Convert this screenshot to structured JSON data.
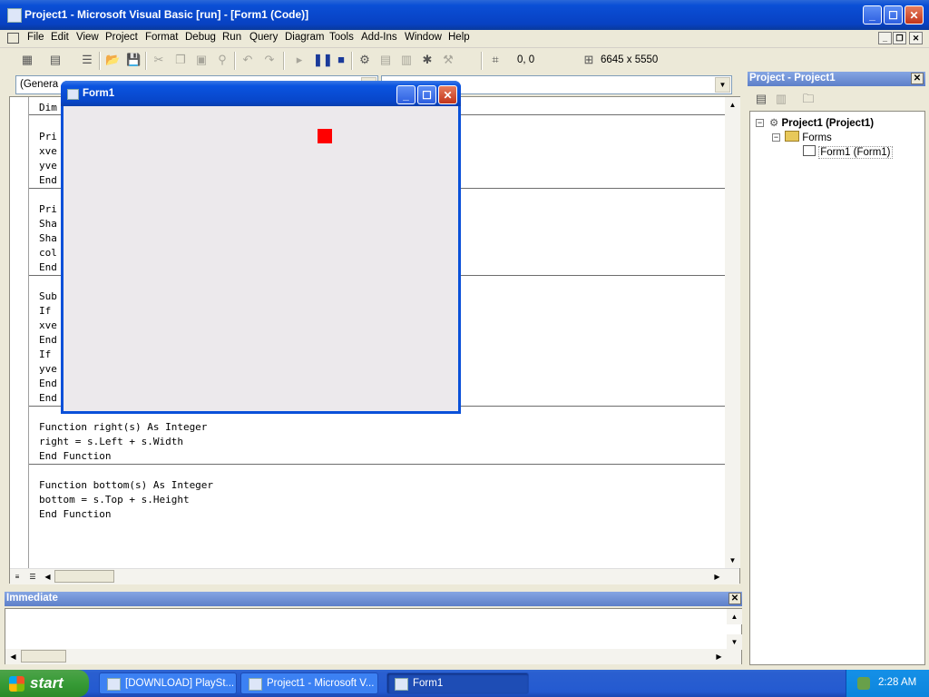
{
  "window": {
    "title": "Project1 - Microsoft Visual Basic [run] - [Form1 (Code)]",
    "minimize_glyph": "_",
    "maximize_glyph": "☐",
    "close_glyph": "✕"
  },
  "menu": {
    "items": [
      "File",
      "Edit",
      "View",
      "Project",
      "Format",
      "Debug",
      "Run",
      "Query",
      "Diagram",
      "Tools",
      "Add-Ins",
      "Window",
      "Help"
    ],
    "mdi_minimize": "_",
    "mdi_restore": "❐",
    "mdi_close": "✕"
  },
  "toolbar": {
    "position_readout": "0, 0",
    "size_readout": "6645 x 5550",
    "icons": [
      "add-project-icon",
      "add-form-icon",
      "menu-editor-icon",
      "open-icon",
      "save-icon",
      "cut-icon",
      "copy-icon",
      "paste-icon",
      "find-icon",
      "undo-icon",
      "redo-icon",
      "start-icon",
      "break-icon",
      "end-icon",
      "project-explorer-icon",
      "properties-icon",
      "form-layout-icon",
      "object-browser-icon",
      "toolbox-icon"
    ]
  },
  "code_window": {
    "object_combo": "(Genera",
    "lines": [
      "Dim",
      "",
      "Pri",
      "xve",
      "yve",
      "End",
      "",
      "Pri",
      "Sha",
      "Sha",
      "col",
      "End",
      "",
      "Sub",
      "If                                                  n",
      "xve",
      "End",
      "If                                                  en",
      "yve",
      "End",
      "End",
      "",
      "Function right(s) As Integer",
      "right = s.Left + s.Width",
      "End Function",
      "",
      "Function bottom(s) As Integer",
      "bottom = s.Top + s.Height",
      "End Function"
    ]
  },
  "immediate": {
    "title": "Immediate",
    "close_glyph": "✕"
  },
  "project_explorer": {
    "title": "Project - Project1",
    "close_glyph": "✕",
    "root": "Project1 (Project1)",
    "folder": "Forms",
    "form": "Form1 (Form1)"
  },
  "form1": {
    "title": "Form1",
    "minimize_glyph": "_",
    "maximize_glyph": "☐",
    "close_glyph": "✕",
    "shape_color": "#ff0000"
  },
  "taskbar": {
    "start_label": "start",
    "tasks": [
      "[DOWNLOAD] PlaySt...",
      "Project1 - Microsoft V...",
      "Form1"
    ],
    "clock": "2:28 AM"
  }
}
